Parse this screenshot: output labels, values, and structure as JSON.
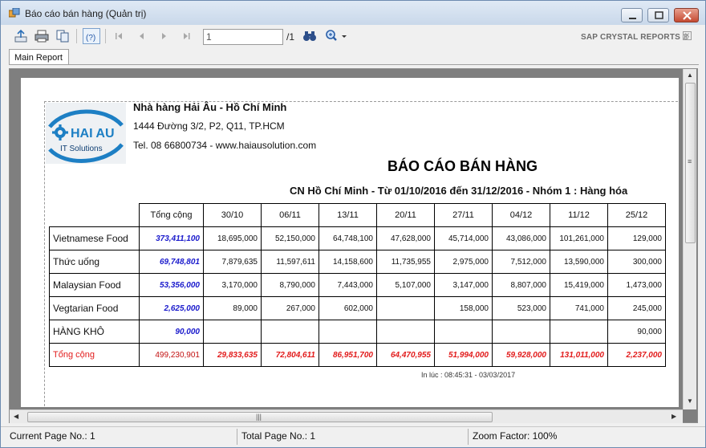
{
  "window": {
    "title": "Báo cáo bán hàng (Quản trị)"
  },
  "toolbar": {
    "page_input_value": "1",
    "page_total": "/1",
    "brand": "SAP CRYSTAL REPORTS",
    "brand_mark": "®"
  },
  "tabs": [
    "Main Report"
  ],
  "report": {
    "logo": {
      "text": "HAI AU",
      "tagline": "IT Solutions"
    },
    "company_name": "Nhà hàng Hải Âu - Hồ Chí Minh",
    "address": "1444 Đường 3/2, P2, Q11, TP.HCM",
    "contact": "Tel. 08 66800734 - www.haiausolution.com",
    "title": "BÁO CÁO BÁN HÀNG",
    "subtitle": "CN Hồ Chí Minh - Từ 01/10/2016 đến 31/12/2016 - Nhóm 1 : Hàng hóa",
    "columns": [
      "Tổng cộng",
      "30/10",
      "06/11",
      "13/11",
      "20/11",
      "27/11",
      "04/12",
      "11/12",
      "25/12"
    ],
    "rows": [
      {
        "label": "Vietnamese Food",
        "total": "373,411,100",
        "values": [
          "18,695,000",
          "52,150,000",
          "64,748,100",
          "47,628,000",
          "45,714,000",
          "43,086,000",
          "101,261,000",
          "129,000"
        ]
      },
      {
        "label": "Thức uống",
        "total": "69,748,801",
        "values": [
          "7,879,635",
          "11,597,611",
          "14,158,600",
          "11,735,955",
          "2,975,000",
          "7,512,000",
          "13,590,000",
          "300,000"
        ]
      },
      {
        "label": "Malaysian Food",
        "total": "53,356,000",
        "values": [
          "3,170,000",
          "8,790,000",
          "7,443,000",
          "5,107,000",
          "3,147,000",
          "8,807,000",
          "15,419,000",
          "1,473,000"
        ]
      },
      {
        "label": "Vegtarian Food",
        "total": "2,625,000",
        "values": [
          "89,000",
          "267,000",
          "602,000",
          "",
          "158,000",
          "523,000",
          "741,000",
          "245,000"
        ]
      },
      {
        "label": "HÀNG KHÔ",
        "total": "90,000",
        "values": [
          "",
          "",
          "",
          "",
          "",
          "",
          "",
          "90,000"
        ]
      }
    ],
    "total_row": {
      "label": "Tổng cộng",
      "total": "499,230,901",
      "values": [
        "29,833,635",
        "72,804,611",
        "86,951,700",
        "64,470,955",
        "51,994,000",
        "59,928,000",
        "131,011,000",
        "2,237,000"
      ]
    },
    "printed_at": "In lúc : 08:45:31 - 03/03/2017"
  },
  "status": {
    "current_page": "Current Page No.: 1",
    "total_page": "Total Page No.: 1",
    "zoom": "Zoom Factor: 100%"
  }
}
